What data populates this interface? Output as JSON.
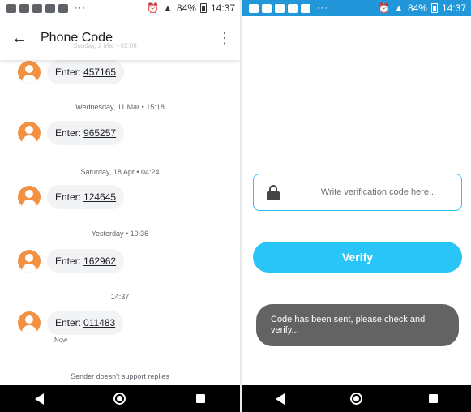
{
  "left_screen": {
    "status_bar": {
      "battery": "84%",
      "time": "14:37",
      "overflow": "···"
    },
    "app_bar": {
      "title": "Phone Code"
    },
    "faded_date": "Sunday, 2 Mar • 02:08",
    "messages": [
      {
        "prefix": "Enter:",
        "code": "457165"
      },
      {
        "date": "Wednesday, 11 Mar • 15:18",
        "prefix": "Enter:",
        "code": "965257"
      },
      {
        "date": "Saturday, 18 Apr • 04:24",
        "prefix": "Enter:",
        "code": "124645"
      },
      {
        "date": "Yesterday • 10:36",
        "prefix": "Enter:",
        "code": "162962"
      },
      {
        "date": "14:37",
        "prefix": "Enter:",
        "code": "011483",
        "sub": "Now"
      }
    ],
    "footer_note": "Sender doesn't support replies"
  },
  "right_screen": {
    "status_bar": {
      "battery": "84%",
      "time": "14:37",
      "overflow": "···"
    },
    "code_input": {
      "placeholder": "Write verification code here...",
      "value": ""
    },
    "verify_button": "Verify",
    "toast": "Code has been sent, please check and verify..."
  },
  "colors": {
    "accent": "#29c5f6",
    "status_bar_right": "#2196d8",
    "avatar": "#f39143",
    "toast": "#636363"
  },
  "icons": [
    "back-arrow-icon",
    "more-vert-icon",
    "contact-avatar-icon",
    "lock-icon",
    "nav-back-icon",
    "nav-home-icon",
    "nav-recents-icon"
  ]
}
